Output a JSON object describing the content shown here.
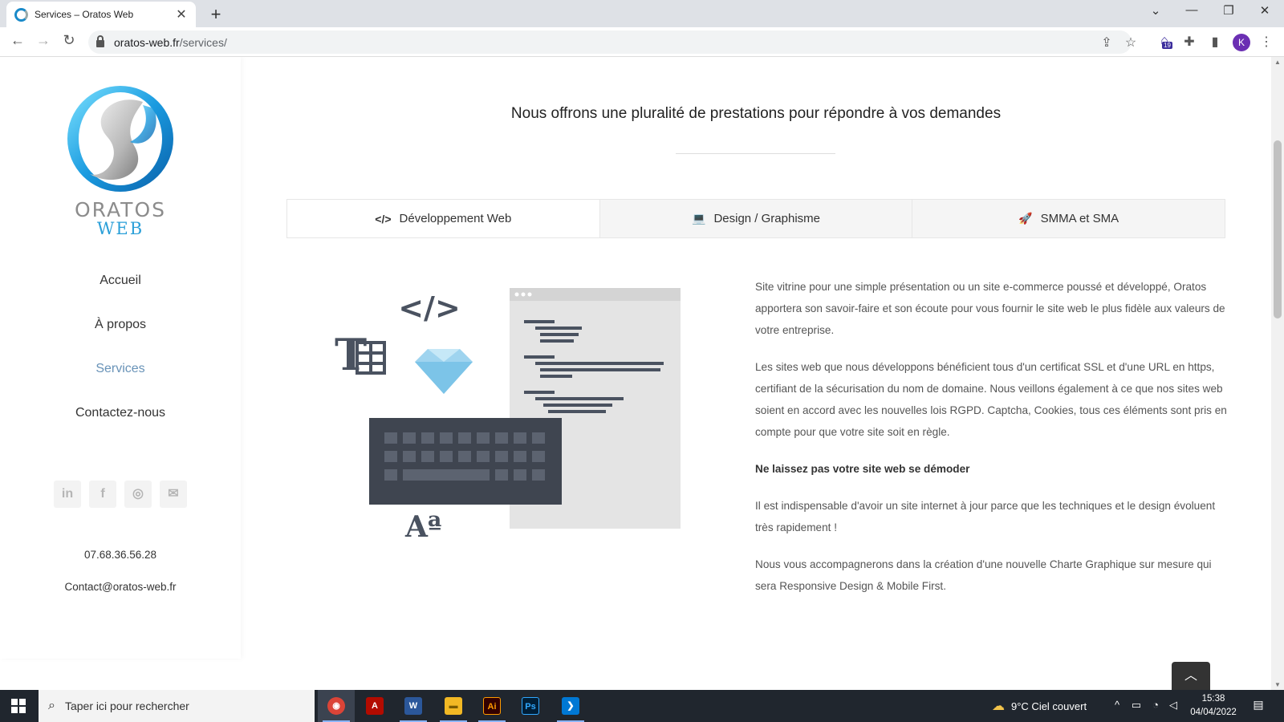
{
  "browser": {
    "tab_title": "Services – Oratos Web",
    "tab_close": "✕",
    "new_tab": "+",
    "url_host": "oratos-web.fr",
    "url_path": "/services/",
    "extension_badge": "19",
    "profile_initial": "K",
    "window_controls": [
      "⌄",
      "—",
      "❐",
      "✕"
    ]
  },
  "sidebar": {
    "logo_line1": "ORATOS",
    "logo_line2": "WEB",
    "menu": [
      {
        "label": "Accueil"
      },
      {
        "label": "À propos"
      },
      {
        "label": "Services"
      },
      {
        "label": "Contactez-nous"
      }
    ],
    "social_icons": [
      "linkedin-icon",
      "facebook-icon",
      "instagram-icon",
      "email-icon"
    ],
    "social_glyphs": [
      "in",
      "f",
      "◎",
      "✉"
    ],
    "phone": "07.68.36.56.28",
    "email": "Contact@oratos-web.fr"
  },
  "main": {
    "headline": "Nous offrons une pluralité de prestations pour répondre à vos demandes",
    "tabs": [
      {
        "label": "Développement Web",
        "icon": "code-icon",
        "glyph": "</>"
      },
      {
        "label": "Design / Graphisme",
        "icon": "laptop-icon",
        "glyph": "💻"
      },
      {
        "label": "SMMA et SMA",
        "icon": "rocket-icon",
        "glyph": "🚀"
      }
    ],
    "paragraphs": [
      "Site vitrine pour une simple présentation ou un site e-commerce poussé et développé, Oratos apportera son savoir-faire et son écoute pour vous fournir le site web le plus fidèle aux valeurs de votre entreprise.",
      "Les sites web que nous développons bénéficient tous d'un certificat SSL et d'une URL en https, certifiant de la sécurisation du nom de domaine. Nous veillons également à ce que nos sites web soient en accord avec les nouvelles lois RGPD. Captcha, Cookies, tous ces éléments sont pris en compte pour que votre site soit en règle.",
      " Ne laissez pas votre site web se démoder",
      "Il est indispensable d'avoir un site internet à jour parce que les techniques et le design évoluent très rapidement !",
      "Nous vous accompagnerons dans la création d'une nouvelle Charte Graphique sur mesure qui sera Responsive Design & Mobile First."
    ],
    "illustration_glyphs": {
      "code": "</>",
      "table": "T",
      "font": "Aª"
    }
  },
  "taskbar": {
    "search_placeholder": "Taper ici pour rechercher",
    "apps": [
      {
        "name": "chrome",
        "glyph": "◉",
        "color": "#db4437"
      },
      {
        "name": "acrobat",
        "glyph": "A",
        "color": "#b30b00"
      },
      {
        "name": "word",
        "glyph": "W",
        "color": "#2b579a"
      },
      {
        "name": "file-explorer",
        "glyph": "▬",
        "color": "#f2b824"
      },
      {
        "name": "illustrator",
        "glyph": "Ai",
        "color": "#330000"
      },
      {
        "name": "photoshop",
        "glyph": "Ps",
        "color": "#001e36"
      },
      {
        "name": "vscode",
        "glyph": "❯",
        "color": "#0078d4"
      }
    ],
    "weather": "9°C  Ciel couvert",
    "time": "15:38",
    "date": "04/04/2022"
  },
  "colors": {
    "accent": "#6993b8",
    "logo_blue": "#2a9fd8",
    "logo_grey": "#8c8c8c"
  }
}
